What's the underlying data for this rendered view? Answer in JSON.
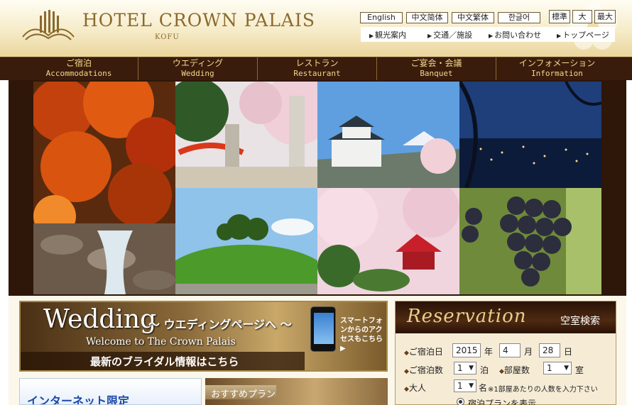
{
  "header": {
    "logo_title": "HOTEL CROWN PALAIS",
    "logo_sub": "KOFU",
    "languages": [
      "English",
      "中文简体",
      "中文繁体",
      "한글어"
    ],
    "text_sizes": [
      "標準",
      "大",
      "最大"
    ],
    "util_links": [
      "観光案内",
      "交通／施設",
      "お問い合わせ",
      "トップページ"
    ]
  },
  "nav": {
    "items": [
      {
        "jp": "ご宿泊",
        "en": "Accommodations"
      },
      {
        "jp": "ウエディング",
        "en": "Wedding"
      },
      {
        "jp": "レストラン",
        "en": "Restaurant"
      },
      {
        "jp": "ご宴会・会議",
        "en": "Banquet"
      },
      {
        "jp": "インフォメーション",
        "en": "Information"
      }
    ]
  },
  "wedding_banner": {
    "title": "Wedding",
    "subtitle": "～ ウエディングページへ ～",
    "welcome": "Welcome to The Crown Palais",
    "bottom_text": "最新のブライダル情報はこちら",
    "smartphone_text": "スマートフォンからのアクセスもこちら ▶"
  },
  "internet_box": {
    "label": "インターネット限定"
  },
  "osusume": {
    "label": "おすすめプラン"
  },
  "reservation": {
    "title": "Reservation",
    "vacancy": "空室検索",
    "date_label": "ご宿泊日",
    "year": "2015",
    "year_unit": "年",
    "month": "4",
    "month_unit": "月",
    "day": "28",
    "day_unit": "日",
    "nights_label": "ご宿泊数",
    "nights": "1",
    "nights_unit": "泊",
    "rooms_label": "部屋数",
    "rooms": "1",
    "rooms_unit": "室",
    "adults_label": "大人",
    "adults": "1",
    "adults_unit": "名",
    "adults_note": "※1部屋あたりの人数を入力下さい",
    "radio_label": "宿泊プランを表示"
  },
  "colors": {
    "nav_bg": "#3a1c0c",
    "nav_text": "#f2d98a",
    "logo_gold": "#8a6a2e",
    "reservation_head": "#2a1206"
  }
}
